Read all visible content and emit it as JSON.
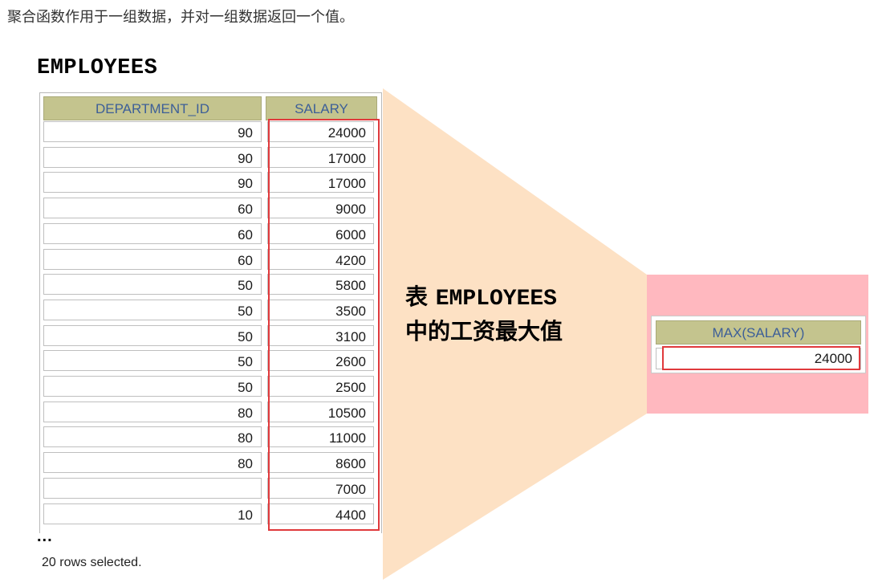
{
  "intro_text": "聚合函数作用于一组数据，并对一组数据返回一个值。",
  "table": {
    "title": "EMPLOYEES",
    "headers": {
      "department_id": "DEPARTMENT_ID",
      "salary": "SALARY"
    },
    "rows": [
      {
        "department_id": "90",
        "salary": "24000"
      },
      {
        "department_id": "90",
        "salary": "17000"
      },
      {
        "department_id": "90",
        "salary": "17000"
      },
      {
        "department_id": "60",
        "salary": "9000"
      },
      {
        "department_id": "60",
        "salary": "6000"
      },
      {
        "department_id": "60",
        "salary": "4200"
      },
      {
        "department_id": "50",
        "salary": "5800"
      },
      {
        "department_id": "50",
        "salary": "3500"
      },
      {
        "department_id": "50",
        "salary": "3100"
      },
      {
        "department_id": "50",
        "salary": "2600"
      },
      {
        "department_id": "50",
        "salary": "2500"
      },
      {
        "department_id": "80",
        "salary": "10500"
      },
      {
        "department_id": "80",
        "salary": "11000"
      },
      {
        "department_id": "80",
        "salary": "8600"
      },
      {
        "department_id": "",
        "salary": "7000"
      },
      {
        "department_id": "10",
        "salary": "4400"
      }
    ],
    "ellipsis": "...",
    "rows_selected": "20 rows selected."
  },
  "caption": {
    "line1_prefix": "表 ",
    "line1_mono": "EMPLOYEES",
    "line2": "中的工资最大值"
  },
  "result": {
    "header": "MAX(SALARY)",
    "value": "24000"
  },
  "colors": {
    "header_bg": "#c4c48e",
    "header_text": "#3d5f98",
    "highlight_border": "#e0393c",
    "funnel_fill": "#fde1c4",
    "result_panel_bg": "#ffb8bf"
  }
}
